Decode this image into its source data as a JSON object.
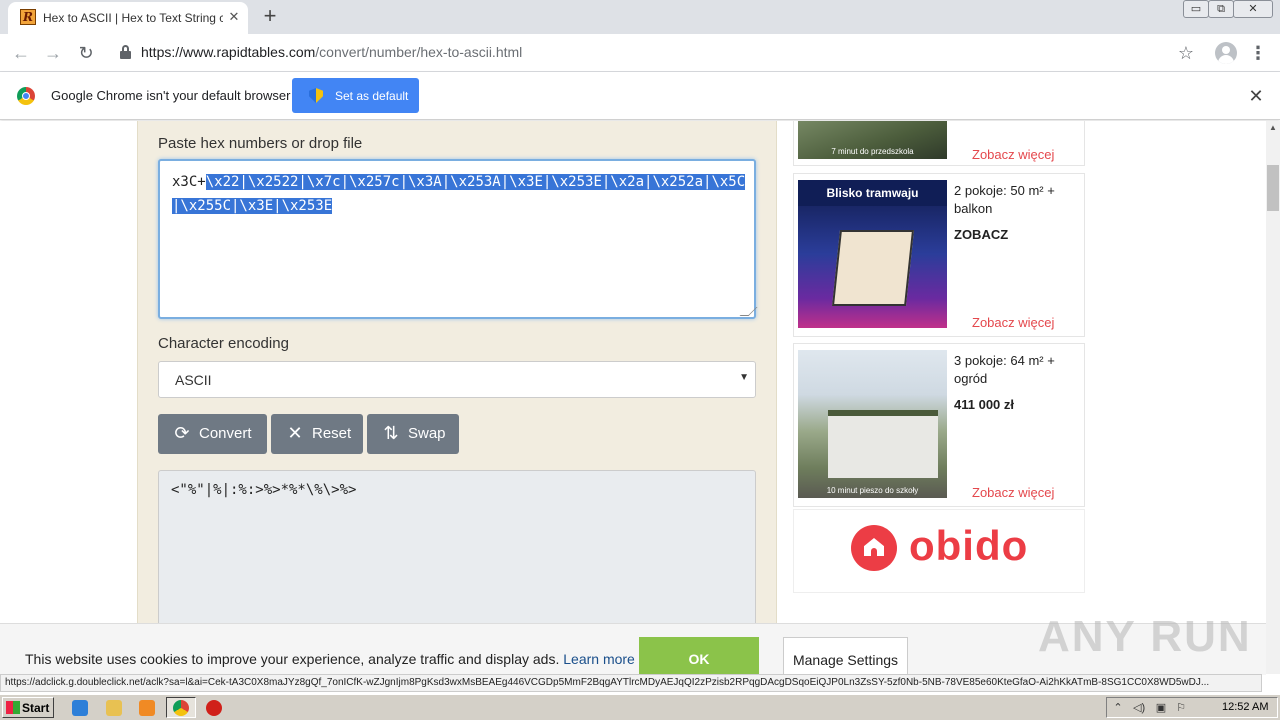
{
  "browser": {
    "tab_title": "Hex to ASCII | Hex to Text String co",
    "tab_favicon_letter": "R",
    "url_domain": "https://www.rapidtables.com",
    "url_path": "/convert/number/hex-to-ascii.html",
    "new_tab_symbol": "+",
    "window_controls": [
      "▭",
      "⧉",
      "✕"
    ]
  },
  "infobar": {
    "message": "Google Chrome isn't your default browser",
    "button_label": "Set as default"
  },
  "converter": {
    "input_label": "Paste hex numbers or drop file",
    "input_plain": "x3C+",
    "input_selected": "\\x22|\\x2522|\\x7c|\\x257c|\\x3A|\\x253A|\\x3E|\\x253E|\\x2a|\\x252a|\\x5C|\\x255C|\\x3E|\\x253E",
    "encoding_label": "Character encoding",
    "encoding_value": "ASCII",
    "buttons": {
      "convert": "Convert",
      "reset": "Reset",
      "swap": "Swap"
    },
    "output": "<\"%\"|%|:%:>%>*%*\\%\\>%>"
  },
  "ads": [
    {
      "title": "",
      "price": "",
      "more": "Zobacz więcej",
      "caption": "7 minut do przedszkola"
    },
    {
      "title": "2 pokoje: 50 m² + balkon",
      "price": "ZOBACZ",
      "more": "Zobacz więcej",
      "caption": "",
      "banner": "Blisko tramwaju"
    },
    {
      "title": "3 pokoje: 64 m² + ogród",
      "price": "411 000 zł",
      "more": "Zobacz więcej",
      "caption": "10 minut pieszo do szkoły"
    }
  ],
  "brand": {
    "name": "obido",
    "color": "#ec3d45"
  },
  "cookie": {
    "message": "This website uses cookies to improve your experience, analyze traffic and display ads.",
    "learn_more": "Learn more",
    "ok": "OK",
    "manage": "Manage Settings"
  },
  "watermark": "ANY RUN",
  "status_url": "https://adclick.g.doubleclick.net/aclk?sa=l&ai=Cek-tA3C0X8maJYz8gQf_7onICfK-wZJgnIjm8PgKsd3wxMsBEAEg446VCGDp5MmF2BqgAYTlrcMDyAEJqQI2zPzisb2RPqgDAcgDSqoEiQJP0Ln3ZsSY-5zf0Nb-5NB-78VE85e60KteGfaO-Ai2hKkATmB-8SG1CC0X8WD5wDJ...",
  "taskbar": {
    "start_label": "Start",
    "clock": "12:52 AM"
  }
}
